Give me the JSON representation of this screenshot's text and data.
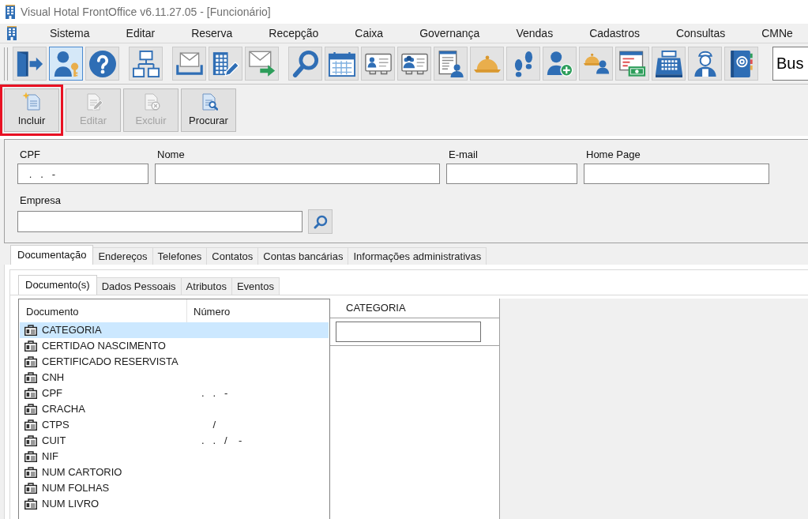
{
  "window": {
    "title": "Visual Hotal FrontOffice v6.11.27.05 - [Funcionário]"
  },
  "menu": {
    "items": [
      "Sistema",
      "Editar",
      "Reserva",
      "Recepção",
      "Caixa",
      "Governança",
      "Vendas",
      "Cadastros",
      "Consultas",
      "CMNe"
    ]
  },
  "toolbar": {
    "groups": [
      [
        {
          "kind": "exit",
          "selected": false
        },
        {
          "kind": "user_key",
          "selected": true
        },
        {
          "kind": "help",
          "selected": false
        }
      ],
      [
        {
          "kind": "org_chart",
          "selected": false
        }
      ],
      [
        {
          "kind": "envelope_tray",
          "selected": false
        },
        {
          "kind": "building_pen",
          "selected": false
        },
        {
          "kind": "envelope_arrow",
          "selected": false
        }
      ],
      [
        {
          "kind": "search",
          "selected": false
        },
        {
          "kind": "calendar",
          "selected": false
        },
        {
          "kind": "id_card",
          "selected": false
        },
        {
          "kind": "id_card_people",
          "selected": false
        },
        {
          "kind": "document_people",
          "selected": false
        },
        {
          "kind": "dome_bell",
          "selected": false
        },
        {
          "kind": "footprints",
          "selected": false
        },
        {
          "kind": "user_plus",
          "selected": false
        },
        {
          "kind": "bell_people",
          "selected": false
        },
        {
          "kind": "window_money",
          "selected": false
        },
        {
          "kind": "cash_register",
          "selected": false
        },
        {
          "kind": "maid",
          "selected": false
        },
        {
          "kind": "address_book",
          "selected": false
        }
      ]
    ],
    "search": {
      "value": "Bus"
    }
  },
  "actions": [
    {
      "kind": "new",
      "label": "Incluir",
      "disabled": false,
      "highlighted": true
    },
    {
      "kind": "edit",
      "label": "Editar",
      "disabled": true,
      "highlighted": false
    },
    {
      "kind": "delete",
      "label": "Excluir",
      "disabled": true,
      "highlighted": false
    },
    {
      "kind": "find",
      "label": "Procurar",
      "disabled": false,
      "highlighted": false
    }
  ],
  "form": {
    "fields": [
      {
        "label": "CPF",
        "value": "   .   .   -"
      },
      {
        "label": "Nome"
      },
      {
        "label": "E-mail"
      },
      {
        "label": "Home Page"
      }
    ],
    "lookup": {
      "label": "Empresa"
    }
  },
  "tabs": [
    {
      "label": "Documentação",
      "selected": true
    },
    {
      "label": "Endereços",
      "selected": false
    },
    {
      "label": "Telefones",
      "selected": false
    },
    {
      "label": "Contatos",
      "selected": false
    },
    {
      "label": "Contas bancárias",
      "selected": false
    },
    {
      "label": "Informações administrativas",
      "selected": false
    }
  ],
  "subtabs": [
    {
      "label": "Documento(s)",
      "selected": true
    },
    {
      "label": "Dados Pessoais",
      "selected": false
    },
    {
      "label": "Atributos",
      "selected": false
    },
    {
      "label": "Eventos",
      "selected": false
    }
  ],
  "documents": {
    "columns": [
      "Documento",
      "Número"
    ],
    "rows": [
      {
        "name": "CATEGORIA",
        "selected": true
      },
      {
        "name": "CERTIDAO NASCIMENTO",
        "selected": false
      },
      {
        "name": "CERTIFICADO RESERVISTA",
        "selected": false
      },
      {
        "name": "CNH",
        "selected": false
      },
      {
        "name": "CPF",
        "number": ".   .   -",
        "selected": false
      },
      {
        "name": "CRACHA",
        "selected": false
      },
      {
        "name": "CTPS",
        "number": "    /",
        "selected": false
      },
      {
        "name": "CUIT",
        "number": ".   .   /    -",
        "selected": false
      },
      {
        "name": "NIF",
        "selected": false
      },
      {
        "name": "NUM CARTORIO",
        "selected": false
      },
      {
        "name": "NUM FOLHAS",
        "selected": false
      },
      {
        "name": "NUM LIVRO",
        "selected": false
      }
    ]
  },
  "category_panel": {
    "title": "CATEGORIA"
  }
}
